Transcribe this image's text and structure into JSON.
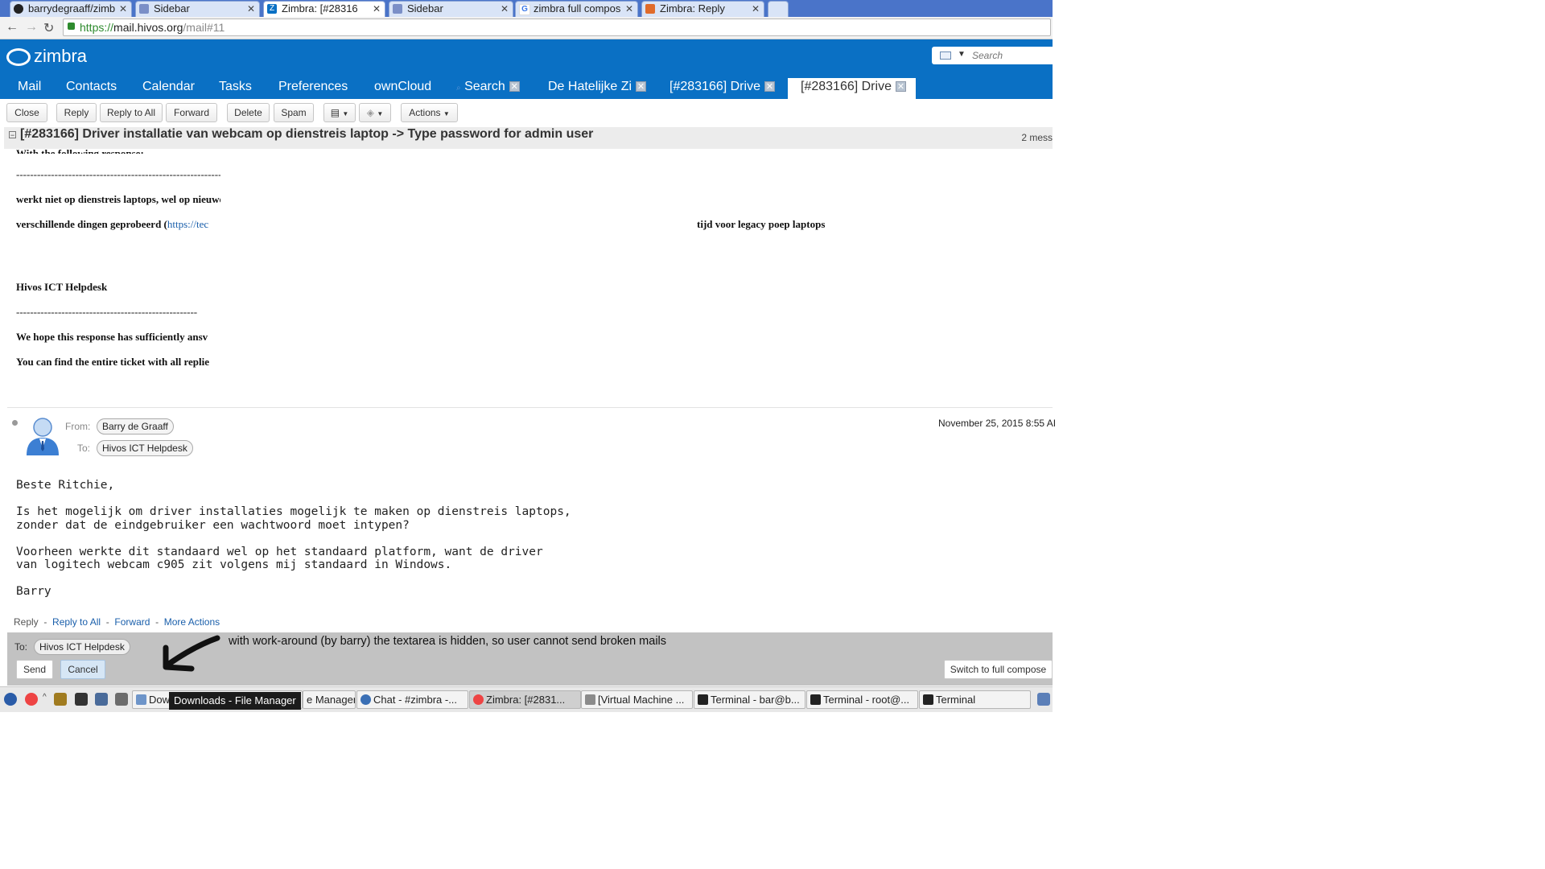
{
  "browser": {
    "tabs": [
      {
        "label": "barrydegraaff/zimb"
      },
      {
        "label": "Sidebar"
      },
      {
        "label": "Zimbra: [#28316"
      },
      {
        "label": "Sidebar"
      },
      {
        "label": "zimbra full compos"
      },
      {
        "label": "Zimbra: Reply"
      }
    ],
    "url_scheme": "https://",
    "url_host": "mail.hivos.org",
    "url_path": "/mail#11"
  },
  "zimbra": {
    "logo_text": "zimbra",
    "search_placeholder": "Search",
    "app_tabs": [
      "Mail",
      "Contacts",
      "Calendar",
      "Tasks",
      "Preferences",
      "ownCloud",
      "Search",
      "De Hatelijke Zi",
      "[#283166] Drive",
      "[#283166] Drive"
    ]
  },
  "toolbar": {
    "close": "Close",
    "reply": "Reply",
    "reply_all": "Reply to All",
    "forward": "Forward",
    "delete": "Delete",
    "spam": "Spam",
    "actions": "Actions"
  },
  "conversation": {
    "subject": "[#283166] Driver installatie van webcam op dienstreis laptop -> Type password for admin user",
    "count": "2 mess"
  },
  "message1": {
    "cut_line": "With the following response:",
    "dashes": "--------------------------------------------------------------------------------------------------------------------",
    "line1": "werkt niet op dienstreis laptops, wel op nieuwe hmw dingen",
    "line2_start": "verschillende dingen geprobeerd (",
    "line2_link": "https://tec",
    "line2_end": "tijd voor legacy poep laptops",
    "signature": "Hivos ICT Helpdesk",
    "dashes2": "----------------------------------------------------",
    "line3": "We hope this response has sufficiently ansv",
    "line4": "You can find the entire ticket with all replie"
  },
  "message2": {
    "from_label": "From:",
    "from": "Barry de Graaff",
    "to_label": "To:",
    "to": "Hivos ICT Helpdesk",
    "date": "November 25, 2015 8:55 AI",
    "body": [
      "Beste Ritchie,",
      "",
      "Is het mogelijk om driver installaties mogelijk te maken op dienstreis laptops,",
      "zonder dat de eindgebruiker een wachtwoord moet intypen?",
      "",
      "Voorheen werkte dit standaard wel op het standaard platform, want de driver",
      "van logitech webcam c905 zit volgens mij standaard in Windows.",
      "",
      "Barry"
    ],
    "links": {
      "reply": "Reply",
      "reply_all": "Reply to All",
      "forward": "Forward",
      "more": "More Actions"
    }
  },
  "reply": {
    "to_label": "To:",
    "to": "Hivos ICT Helpdesk",
    "send": "Send",
    "cancel": "Cancel",
    "full_compose": "Switch to full compose",
    "annotation": "with work-around (by barry) the textarea is hidden, so user cannot send broken mails"
  },
  "taskbar": {
    "items": [
      "Dow",
      "e Manager",
      "Chat - #zimbra -...",
      "Zimbra: [#2831...",
      "[Virtual Machine ...",
      "Terminal - bar@b...",
      "Terminal - root@...",
      "Terminal"
    ],
    "tooltip": "Downloads - File Manager"
  },
  "colors": {
    "zimbra_blue": "#0a70c4",
    "link": "#1a5fab",
    "reply_pane": "#c2c2c2"
  }
}
